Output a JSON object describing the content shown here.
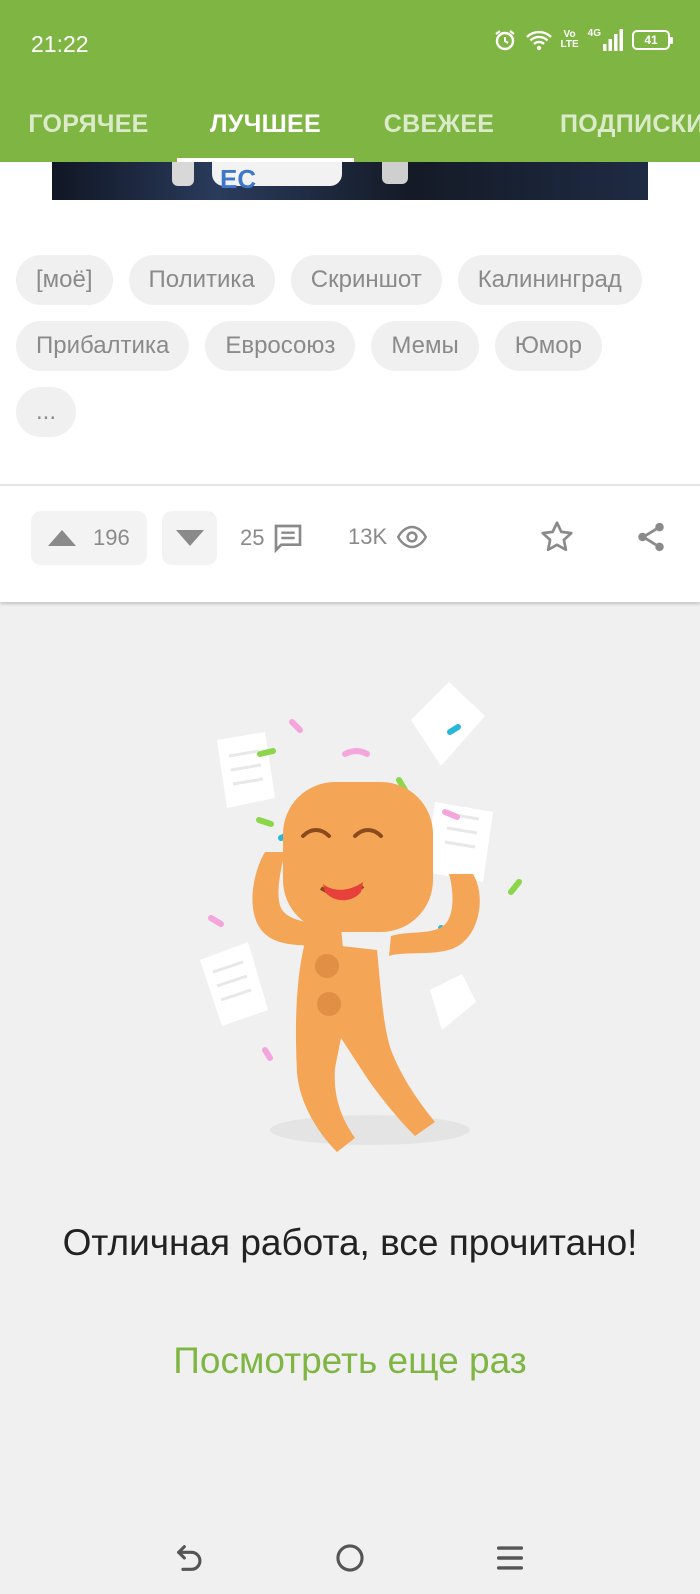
{
  "status_bar": {
    "time": "21:22",
    "network_vo": "Vo",
    "network_lte": "LTE",
    "network_4g": "4G",
    "battery": "41"
  },
  "tabs": [
    {
      "label": "ГОРЯЧЕЕ",
      "active": false
    },
    {
      "label": "ЛУЧШЕЕ",
      "active": true
    },
    {
      "label": "СВЕЖЕЕ",
      "active": false
    },
    {
      "label": "ПОДПИСКИ",
      "active": false
    }
  ],
  "post": {
    "tags": [
      "[моё]",
      "Политика",
      "Скриншот",
      "Калининград",
      "Прибалтика",
      "Евросоюз",
      "Мемы",
      "Юмор",
      "..."
    ],
    "upvotes": "196",
    "comments": "25",
    "views": "13K"
  },
  "feed_end": {
    "message": "Отличная работа, все прочитано!",
    "again_link": "Посмотреть еще раз"
  },
  "colors": {
    "accent": "#7fb643",
    "background": "#f0f0f0",
    "mascot": "#f4a556"
  }
}
